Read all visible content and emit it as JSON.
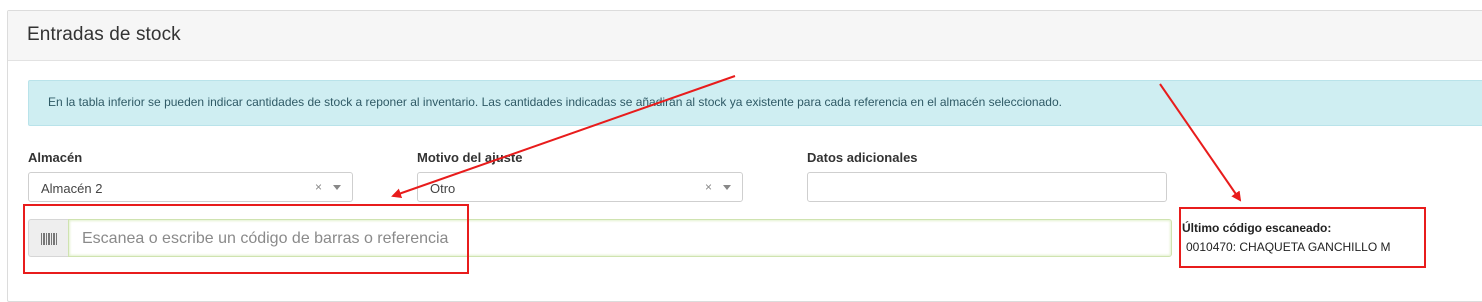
{
  "panel": {
    "title": "Entradas de stock"
  },
  "alert": {
    "text": "En la tabla inferior se pueden indicar cantidades de stock a reponer al inventario. Las cantidades indicadas se añadirán al stock ya existente para cada referencia en el almacén seleccionado."
  },
  "form": {
    "almacen": {
      "label": "Almacén",
      "value": "Almacén 2",
      "clear": "×"
    },
    "motivo": {
      "label": "Motivo del ajuste",
      "value": "Otro",
      "clear": "×"
    },
    "datos": {
      "label": "Datos adicionales",
      "value": ""
    }
  },
  "scan": {
    "icon": "barcode-icon",
    "placeholder": "Escanea o escribe un código de barras o referencia"
  },
  "last_scanned": {
    "label": "Último código escaneado:",
    "value": "0010470: CHAQUETA GANCHILLO M"
  },
  "annotation_color": "#e81c1c"
}
